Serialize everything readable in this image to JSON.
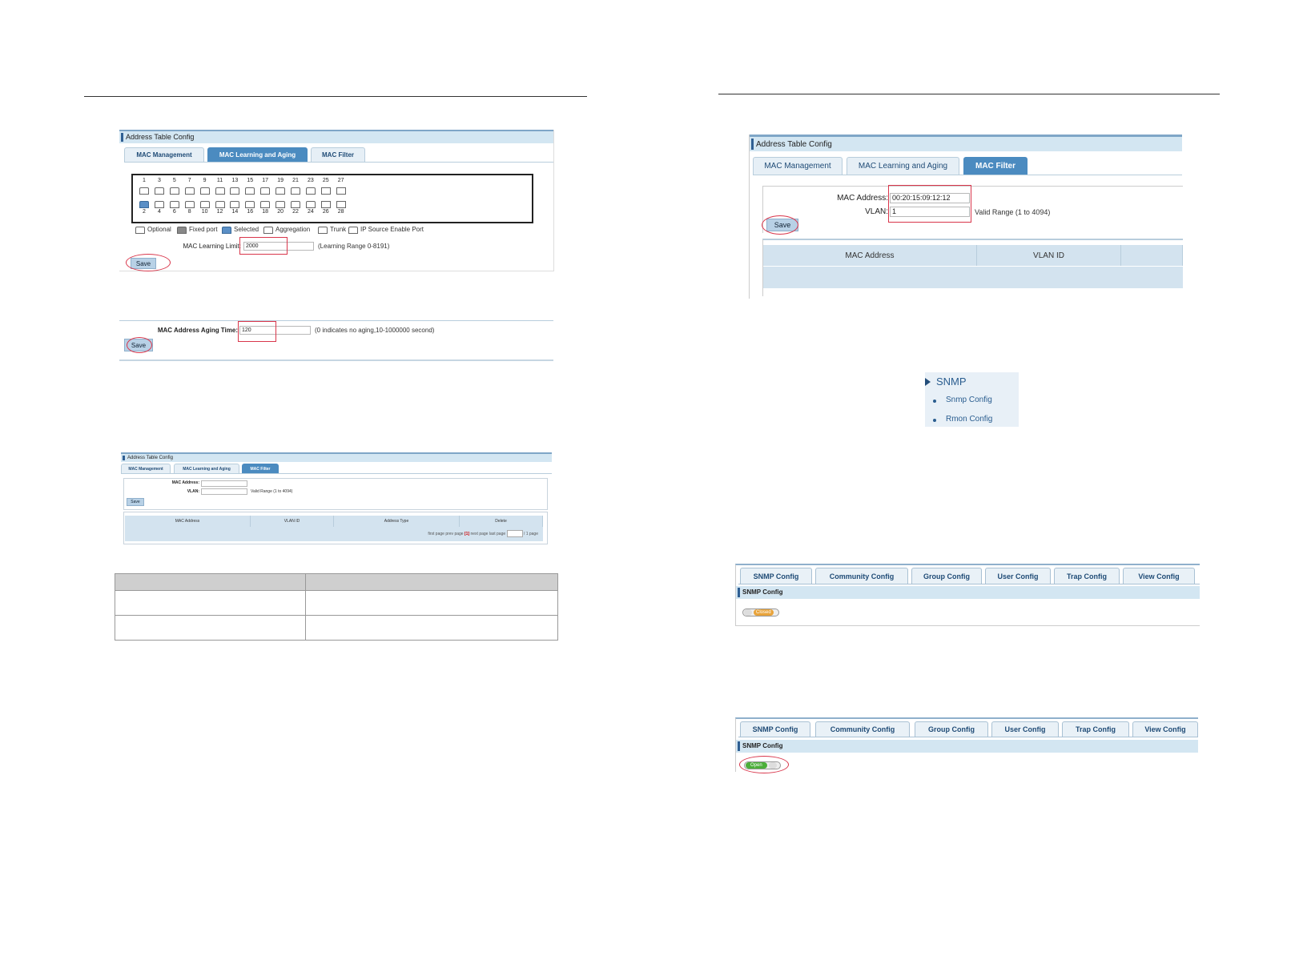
{
  "fig1": {
    "title": "Address Table Config",
    "tabs": [
      "MAC Management",
      "MAC Learning and Aging",
      "MAC Filter"
    ],
    "active_tab": 1,
    "ports_top": [
      "1",
      "3",
      "5",
      "7",
      "9",
      "11",
      "13",
      "15",
      "17",
      "19",
      "21",
      "23",
      "25",
      "27"
    ],
    "ports_bottom": [
      "2",
      "4",
      "6",
      "8",
      "10",
      "12",
      "14",
      "16",
      "18",
      "20",
      "22",
      "24",
      "26",
      "28"
    ],
    "legend": [
      "Optional",
      "Fixed port",
      "Selected",
      "Aggregation",
      "Trunk",
      "IP Source Enable Port"
    ],
    "limit_label": "MAC Learning Limit:",
    "limit_value": "2000",
    "limit_hint": "(Learning Range 0-8191)",
    "save_label": "Save"
  },
  "fig2": {
    "aging_label": "MAC Address Aging Time:",
    "aging_value": "120",
    "aging_hint": "(0 indicates no aging,10-1000000 second)",
    "save_label": "Save"
  },
  "fig3": {
    "title": "Address Table Config",
    "tabs": [
      "MAC Management",
      "MAC Learning and Aging",
      "MAC Filter"
    ],
    "active_tab": 2,
    "mac_label": "MAC Address:",
    "vlan_label": "VLAN:",
    "vlan_hint": "Valid Range (1 to 4094)",
    "save_label": "Save",
    "columns": [
      "MAC Address",
      "VLAN ID",
      "Address Type",
      "Delete"
    ],
    "pager": {
      "first": "first page",
      "prev": "prev page",
      "current": "[1]",
      "next": "next page",
      "last": "last page",
      "suffix": "/ 1 page"
    }
  },
  "fig4": {
    "title": "Address Table Config",
    "tabs": [
      "MAC Management",
      "MAC Learning and Aging",
      "MAC Filter"
    ],
    "active_tab": 2,
    "mac_label": "MAC Address:",
    "mac_value": "00:20:15:09:12:12",
    "vlan_label": "VLAN:",
    "vlan_value": "1",
    "vlan_hint": "Valid Range (1 to 4094)",
    "save_label": "Save",
    "columns": [
      "MAC Address",
      "VLAN ID"
    ]
  },
  "snmp_menu": {
    "heading": "SNMP",
    "items": [
      "Snmp Config",
      "Rmon Config"
    ]
  },
  "fig5": {
    "tabs": [
      "SNMP Config",
      "Community Config",
      "Group Config",
      "User Config",
      "Trap Config",
      "View Config"
    ],
    "section": "SNMP Config",
    "toggle_label": "Closed",
    "toggle_color": "#e8a33a"
  },
  "fig6": {
    "tabs": [
      "SNMP Config",
      "Community Config",
      "Group Config",
      "User Config",
      "Trap Config",
      "View Config"
    ],
    "section": "SNMP Config",
    "toggle_label": "Open",
    "toggle_color": "#4caf3a"
  }
}
